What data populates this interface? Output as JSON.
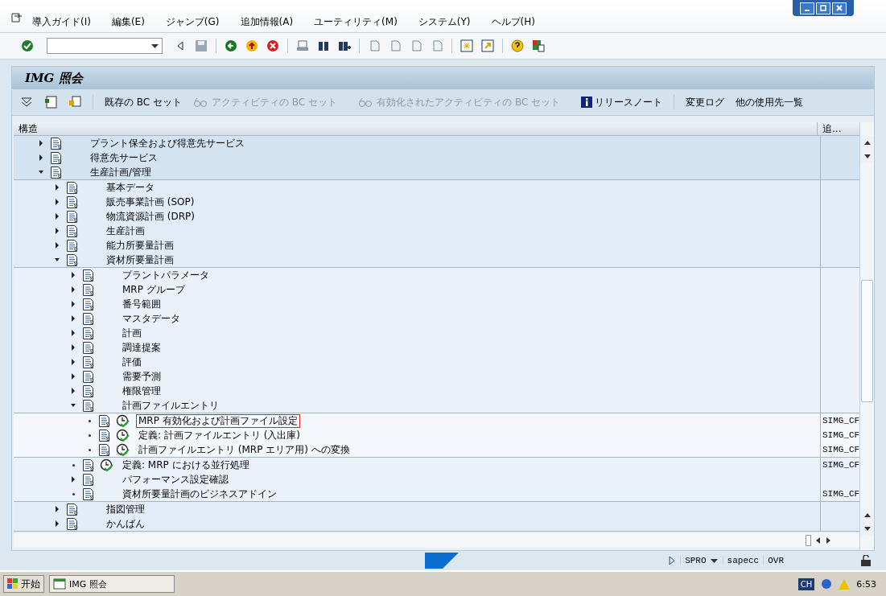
{
  "menu_bar": [
    {
      "label": "導入ガイド(I)"
    },
    {
      "label": "編集(E)"
    },
    {
      "label": "ジャンプ(G)"
    },
    {
      "label": "追加情報(A)"
    },
    {
      "label": "ユーティリティ(M)"
    },
    {
      "label": "システム(Y)"
    },
    {
      "label": "ヘルプ(H)"
    }
  ],
  "panel_title": "IMG 照会",
  "app_toolbar": [
    {
      "kind": "text",
      "label": "既存の BC セット",
      "disabled": false
    },
    {
      "kind": "glasses",
      "label": "アクティビティの BC セット",
      "disabled": true
    },
    {
      "kind": "glasses",
      "label": "有効化されたアクティビティの BC セット",
      "disabled": true
    },
    {
      "kind": "info",
      "label": "リリースノート",
      "disabled": false
    },
    {
      "kind": "text",
      "label": "変更ログ",
      "disabled": false
    },
    {
      "kind": "text",
      "label": "他の使用先一覧",
      "disabled": false
    }
  ],
  "columns": [
    "構造",
    "追..."
  ],
  "tree": [
    {
      "kind": "node",
      "label": "プラント保全および得意先サービス",
      "expanded": false
    },
    {
      "kind": "node",
      "label": "得意先サービス",
      "expanded": false
    },
    {
      "kind": "node",
      "label": "生産計画/管理",
      "expanded": true,
      "children": [
        {
          "kind": "node",
          "label": "基本データ",
          "expanded": false
        },
        {
          "kind": "node",
          "label": "販売事業計画 (SOP)",
          "expanded": false
        },
        {
          "kind": "node",
          "label": "物流資源計画 (DRP)",
          "expanded": false
        },
        {
          "kind": "node",
          "label": "生産計画",
          "expanded": false
        },
        {
          "kind": "node",
          "label": "能力所要量計画",
          "expanded": false
        },
        {
          "kind": "node",
          "label": "資材所要量計画",
          "expanded": true,
          "children": [
            {
              "kind": "node",
              "label": "プラントパラメータ",
              "expanded": false
            },
            {
              "kind": "node",
              "label": "MRP グループ",
              "expanded": false
            },
            {
              "kind": "node",
              "label": "番号範囲",
              "expanded": false
            },
            {
              "kind": "node",
              "label": "マスタデータ",
              "expanded": false
            },
            {
              "kind": "node",
              "label": "計画",
              "expanded": false
            },
            {
              "kind": "node",
              "label": "調達提案",
              "expanded": false
            },
            {
              "kind": "node",
              "label": "評価",
              "expanded": false
            },
            {
              "kind": "node",
              "label": "需要予測",
              "expanded": false
            },
            {
              "kind": "node",
              "label": "権限管理",
              "expanded": false
            },
            {
              "kind": "node",
              "label": "計画ファイルエントリ",
              "expanded": true,
              "children": [
                {
                  "kind": "activity",
                  "label": "MRP 有効化および計画ファイル設定",
                  "selected": true,
                  "tech_name": "SIMG_CF"
                },
                {
                  "kind": "activity",
                  "label": "定義: 計画ファイルエントリ (入出庫)",
                  "selected": false,
                  "tech_name": "SIMG_CF"
                },
                {
                  "kind": "activity",
                  "label": "計画ファイルエントリ (MRP エリア用) への変換",
                  "selected": false,
                  "tech_name": "SIMG_CF"
                }
              ]
            },
            {
              "kind": "activity",
              "label": "定義: MRP における並行処理",
              "selected": false,
              "tech_name": "SIMG_CF"
            },
            {
              "kind": "node",
              "label": "パフォーマンス設定確認",
              "expanded": false
            },
            {
              "kind": "document",
              "label": "資材所要量計画のビジネスアドイン",
              "tech_name": "SIMG_CF"
            }
          ]
        },
        {
          "kind": "node",
          "label": "指図管理",
          "expanded": false
        },
        {
          "kind": "node",
          "label": "かんばん",
          "expanded": false
        }
      ]
    }
  ],
  "status_bar": {
    "transaction": "SPRO",
    "server": "sapecc",
    "mode": "OVR"
  },
  "taskbar": {
    "start": "开始",
    "task": "IMG 照会",
    "language": "CH",
    "time": "6:53"
  }
}
